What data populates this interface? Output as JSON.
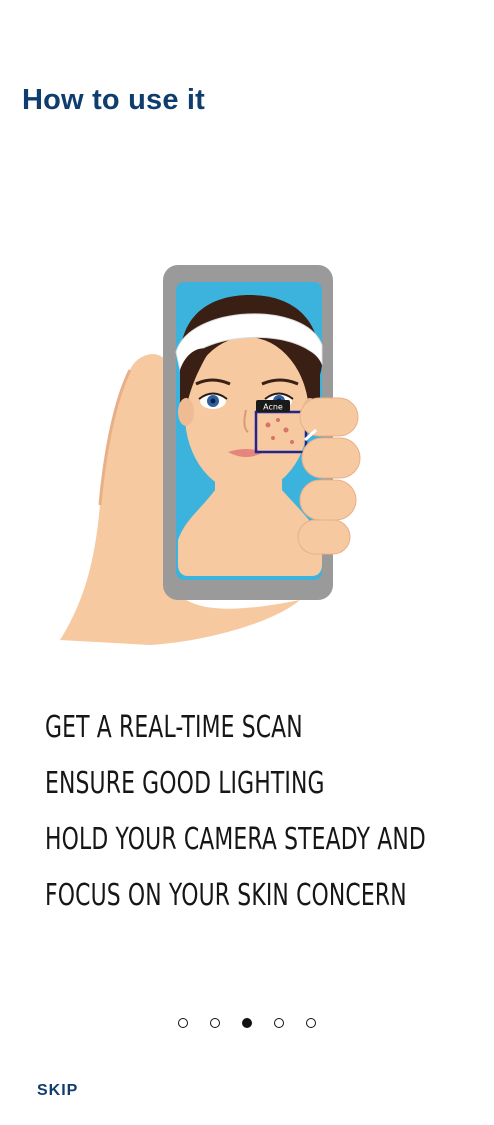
{
  "header": {
    "title": "How to use it"
  },
  "illustration": {
    "icon": "phone-skin-scan-illustration",
    "detection_label": "Acne"
  },
  "instructions": [
    "Get a real-time scan",
    "Ensure good lighting",
    "Hold your camera steady and",
    "focus on your skin concern"
  ],
  "pager": {
    "total": 5,
    "current": 3
  },
  "footer": {
    "skip_label": "SKIP"
  },
  "colors": {
    "title": "#0f3d6e",
    "phone_frame": "#9a9a9a",
    "screen_bg": "#3cb3dc",
    "skin": "#f6c9a0",
    "detection_box": "#23248c"
  }
}
